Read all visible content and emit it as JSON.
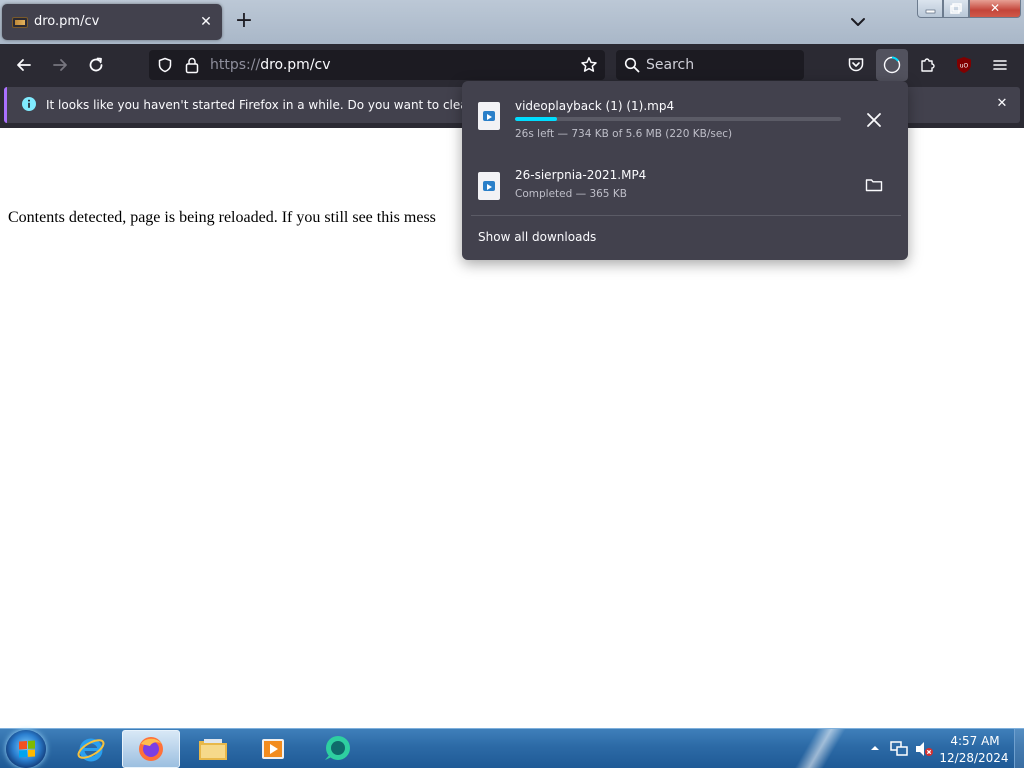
{
  "tab": {
    "title": "dro.pm/cv",
    "close_glyph": "✕",
    "new_tab_glyph": "+"
  },
  "window_controls": {
    "close_glyph": "✕"
  },
  "navbar": {
    "url_scheme": "https://",
    "url_rest": "dro.pm/cv",
    "search_placeholder": "Search",
    "addon_badge": "uO"
  },
  "notification": {
    "text": "It looks like you haven't started Firefox in a while. Do you want to clean it up for",
    "close_glyph": "✕"
  },
  "page": {
    "message": "Contents detected, page is being reloaded. If you still see this mess"
  },
  "downloads_panel": {
    "items": [
      {
        "name": "videoplayback (1) (1).mp4",
        "status": "26s left — 734 KB of 5.6 MB (220 KB/sec)",
        "progress": 0.13,
        "action_icon": "close-icon"
      },
      {
        "name": "26-sierpnia-2021.MP4",
        "status": "Completed — 365 KB",
        "action_icon": "folder-icon"
      }
    ],
    "show_all_label": "Show all downloads"
  },
  "taskbar": {
    "time": "4:57 AM",
    "date": "12/28/2024",
    "items": [
      "internet-explorer-icon",
      "firefox-icon",
      "file-explorer-icon",
      "media-player-icon",
      "app-icon"
    ]
  },
  "colors": {
    "toolbar_bg": "#2b2a33",
    "panel_bg": "#42414d",
    "progress_fill": "#00ddff",
    "notification_accent": "#ab71ff"
  }
}
